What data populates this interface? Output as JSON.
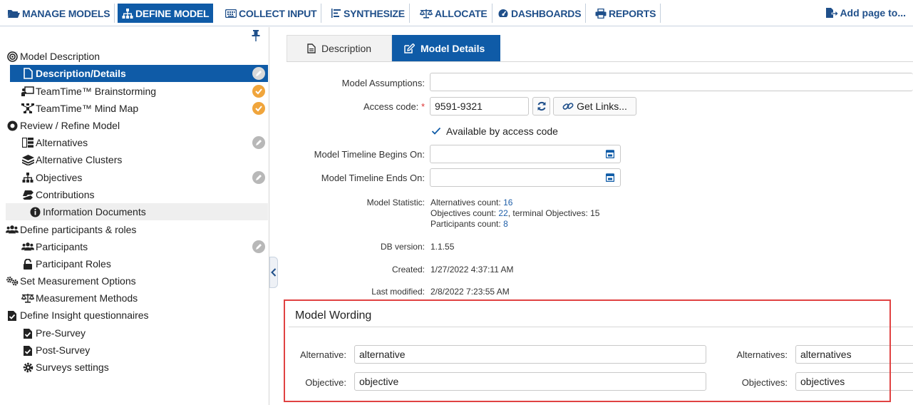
{
  "nav": {
    "items": [
      {
        "label": "MANAGE MODELS",
        "icon": "folder-open-icon"
      },
      {
        "label": "DEFINE MODEL",
        "icon": "hierarchy-icon",
        "active": true
      },
      {
        "label": "COLLECT INPUT",
        "icon": "keyboard-icon"
      },
      {
        "label": "SYNTHESIZE",
        "icon": "bar-list-icon"
      },
      {
        "label": "ALLOCATE",
        "icon": "balance-scale-icon"
      },
      {
        "label": "DASHBOARDS",
        "icon": "gauge-icon"
      },
      {
        "label": "REPORTS",
        "icon": "printer-icon"
      }
    ],
    "add_page": "Add page to..."
  },
  "sidebar": {
    "items": [
      {
        "label": "Model Description",
        "icon": "bullseye-icon"
      },
      {
        "label": "Description/Details",
        "icon": "file-icon",
        "status": "pending",
        "selected": true
      },
      {
        "label": "TeamTime™ Brainstorming",
        "icon": "presentation-icon",
        "status": "done"
      },
      {
        "label": "TeamTime™ Mind Map",
        "icon": "mindmap-icon",
        "status": "done"
      },
      {
        "label": "Review / Refine Model",
        "icon": "circle-icon"
      },
      {
        "label": "Alternatives",
        "icon": "alternatives-icon",
        "status": "pending"
      },
      {
        "label": "Alternative Clusters",
        "icon": "layers-icon"
      },
      {
        "label": "Objectives",
        "icon": "hierarchy-icon",
        "status": "pending"
      },
      {
        "label": "Contributions",
        "icon": "contributions-icon"
      },
      {
        "label": "Information Documents",
        "icon": "info-icon",
        "hover": true
      },
      {
        "label": "Define participants & roles",
        "icon": "users-icon"
      },
      {
        "label": "Participants",
        "icon": "users-icon",
        "status": "pending"
      },
      {
        "label": "Participant Roles",
        "icon": "lock-icon"
      },
      {
        "label": "Set Measurement Options",
        "icon": "gears-icon"
      },
      {
        "label": "Measurement Methods",
        "icon": "balance-scale-icon"
      },
      {
        "label": "Define Insight questionnaires",
        "icon": "checklist-icon"
      },
      {
        "label": "Pre-Survey",
        "icon": "checklist-icon"
      },
      {
        "label": "Post-Survey",
        "icon": "checklist-icon"
      },
      {
        "label": "Surveys settings",
        "icon": "gear-icon"
      }
    ]
  },
  "tabs": [
    {
      "label": "Description",
      "icon": "document-icon"
    },
    {
      "label": "Model Details",
      "icon": "edit-icon",
      "active": true
    }
  ],
  "details": {
    "assumptions_label": "Model Assumptions:",
    "assumptions_value": "",
    "access_code_label": "Access code:",
    "access_code_required": "*",
    "access_code_value": "9591-9321",
    "get_links_label": "Get Links...",
    "available_label": "Available by access code",
    "available_checked": true,
    "timeline_begins_label": "Model Timeline Begins On:",
    "timeline_begins_value": "",
    "timeline_ends_label": "Model Timeline Ends On:",
    "timeline_ends_value": "",
    "statistic_label": "Model Statistic:",
    "alt_count_prefix": "Alternatives count: ",
    "alt_count": "16",
    "obj_count_prefix": "Objectives count: ",
    "obj_count": "22",
    "terminal_obj": ", terminal Objectives: 15",
    "part_count_prefix": "Participants count: ",
    "part_count": "8",
    "db_version_label": "DB version:",
    "db_version": "1.1.55",
    "created_label": "Created:",
    "created": "1/27/2022 4:37:11 AM",
    "modified_label": "Last modified:",
    "modified": "2/8/2022 7:23:55 AM"
  },
  "wording": {
    "title": "Model Wording",
    "alternative_label": "Alternative:",
    "alternative_value": "alternative",
    "alternatives_label": "Alternatives:",
    "alternatives_value": "alternatives",
    "objective_label": "Objective:",
    "objective_value": "objective",
    "objectives_label": "Objectives:",
    "objectives_value": "objectives"
  },
  "colors": {
    "accent": "#0f5ba7",
    "nav_text": "#1f4f8a",
    "status_done": "#f0a53c",
    "status_pending": "#b8b8b8",
    "highlight": "#e04242"
  }
}
